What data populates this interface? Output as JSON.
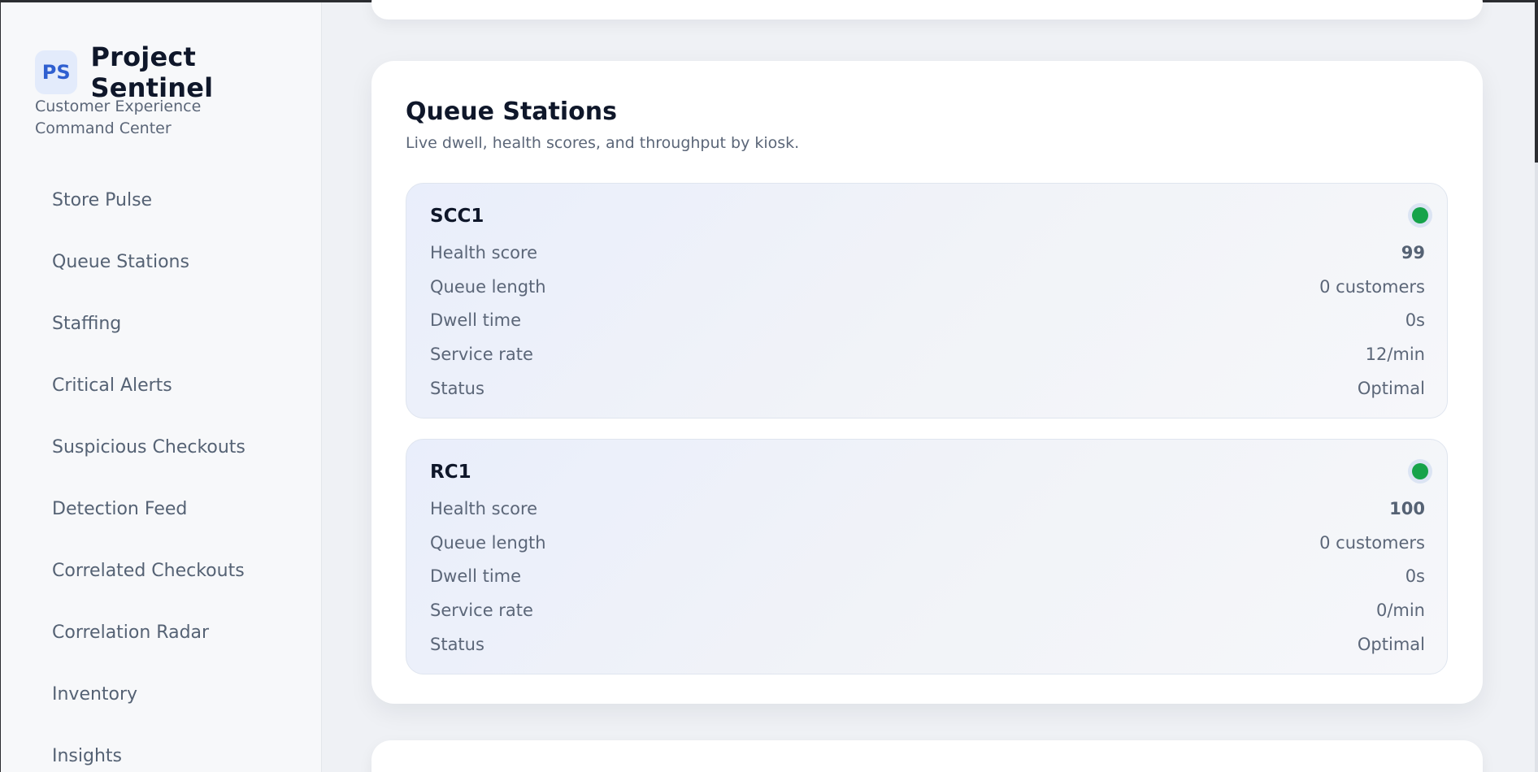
{
  "sidebar": {
    "badge": "PS",
    "title": "Project Sentinel",
    "subtitle": "Customer Experience Command Center",
    "items": [
      {
        "label": "Store Pulse"
      },
      {
        "label": "Queue Stations"
      },
      {
        "label": "Staffing"
      },
      {
        "label": "Critical Alerts"
      },
      {
        "label": "Suspicious Checkouts"
      },
      {
        "label": "Detection Feed"
      },
      {
        "label": "Correlated Checkouts"
      },
      {
        "label": "Correlation Radar"
      },
      {
        "label": "Inventory"
      },
      {
        "label": "Insights"
      }
    ]
  },
  "panel": {
    "title": "Queue Stations",
    "subtitle": "Live dwell, health scores, and throughput by kiosk."
  },
  "labels": {
    "health": "Health score",
    "queue": "Queue length",
    "dwell": "Dwell time",
    "rate": "Service rate",
    "status": "Status"
  },
  "stations": [
    {
      "name": "SCC1",
      "health": "99",
      "queue": "0 customers",
      "dwell": "0s",
      "rate": "12/min",
      "status": "Optimal",
      "dot_color": "#16a34a"
    },
    {
      "name": "RC1",
      "health": "100",
      "queue": "0 customers",
      "dwell": "0s",
      "rate": "0/min",
      "status": "Optimal",
      "dot_color": "#16a34a"
    }
  ]
}
